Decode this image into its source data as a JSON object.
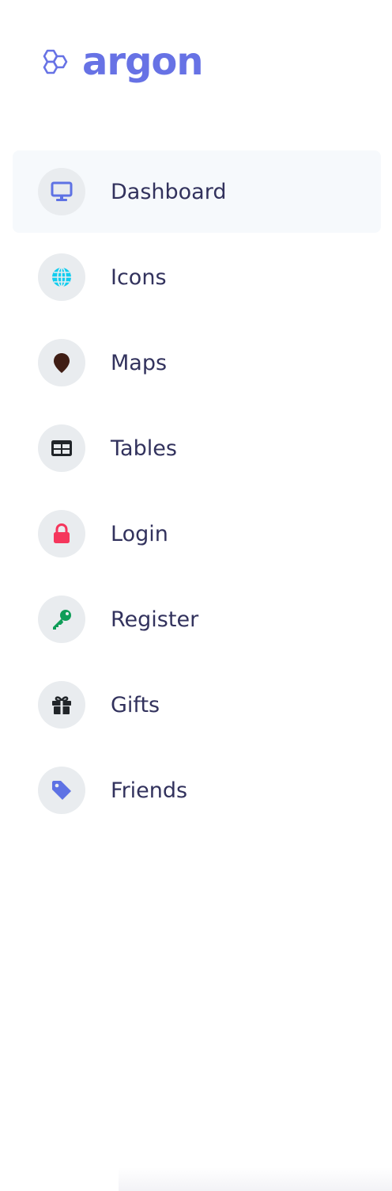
{
  "brand": {
    "name": "argon",
    "color": "#6772e5"
  },
  "nav": {
    "items": [
      {
        "label": "Dashboard",
        "icon": "monitor-icon",
        "color": "#5e72e4",
        "active": true
      },
      {
        "label": "Icons",
        "icon": "globe-icon",
        "color": "#11cdef",
        "active": false
      },
      {
        "label": "Maps",
        "icon": "pin-icon",
        "color": "#3f1d14",
        "active": false
      },
      {
        "label": "Tables",
        "icon": "table-icon",
        "color": "#212529",
        "active": false
      },
      {
        "label": "Login",
        "icon": "lock-icon",
        "color": "#f5365c",
        "active": false
      },
      {
        "label": "Register",
        "icon": "key-icon",
        "color": "#0f9d58",
        "active": false
      },
      {
        "label": "Gifts",
        "icon": "gift-icon",
        "color": "#212529",
        "active": false
      },
      {
        "label": "Friends",
        "icon": "tag-icon",
        "color": "#5e72e4",
        "active": false
      }
    ]
  }
}
